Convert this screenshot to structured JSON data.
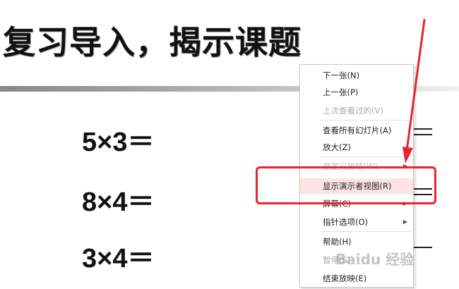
{
  "slide": {
    "title": "复习导入，揭示课题",
    "equations": [
      "5×3＝",
      "8×4＝",
      "3×4＝"
    ]
  },
  "context_menu": {
    "items": [
      {
        "label": "下一张(N)",
        "state": "enabled"
      },
      {
        "label": "上一张(P)",
        "state": "enabled"
      },
      {
        "label": "上次查看过的(V)",
        "state": "disabled"
      },
      {
        "label": "查看所有幻灯片(A)",
        "state": "enabled"
      },
      {
        "label": "放大(Z)",
        "state": "enabled"
      },
      {
        "label": "自定义放映(W)",
        "state": "occluded",
        "submenu": true
      },
      {
        "label": "显示演示者视图(R)",
        "state": "highlighted"
      },
      {
        "label": "屏幕(C)",
        "state": "enabled",
        "submenu": true
      },
      {
        "label": "指针选项(O)",
        "state": "enabled",
        "submenu": true
      },
      {
        "label": "帮助(H)",
        "state": "enabled"
      },
      {
        "label": "暂停(S)",
        "state": "disabled"
      },
      {
        "label": "结束放映(E)",
        "state": "enabled"
      }
    ],
    "submenu_glyph": "▶"
  },
  "annotation": {
    "color": "#e8242d"
  },
  "watermark": {
    "text": "Baidu 经验"
  }
}
